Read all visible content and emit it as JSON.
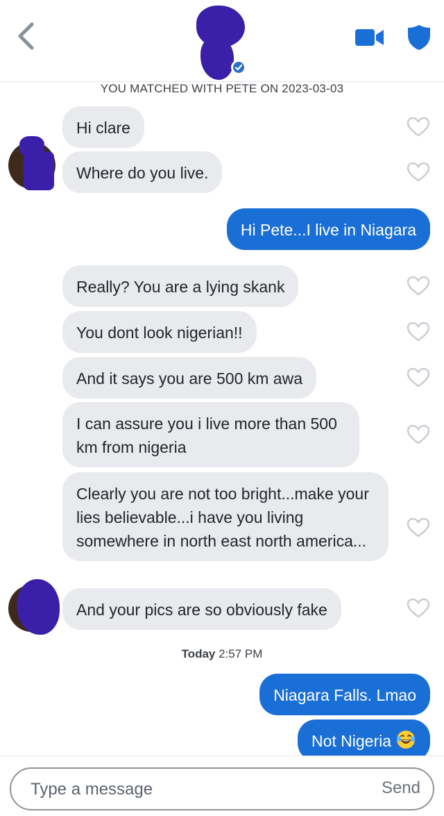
{
  "header": {
    "back_icon": "chevron-left-icon",
    "video_icon": "video-camera-icon",
    "safety_icon": "shield-icon",
    "verified_icon": "verified-check-icon",
    "accent_color": "#1a6fd6"
  },
  "match_banner": "YOU MATCHED WITH PETE ON 2023-03-03",
  "messages_before": [
    {
      "from": "them",
      "text": "Hi clare"
    },
    {
      "from": "them",
      "text": "Where do you live."
    },
    {
      "from": "me",
      "text": "Hi Pete...I live in Niagara"
    },
    {
      "from": "them",
      "text": "Really? You are a lying skank"
    },
    {
      "from": "them",
      "text": "You dont look nigerian!!"
    },
    {
      "from": "them",
      "text": "And it says you are 500 km awa"
    },
    {
      "from": "them",
      "text": "I can assure you i live more than 500 km from nigeria"
    },
    {
      "from": "them",
      "text": "Clearly you are not too bright...make your lies believable...i have you living somewhere in north east north america..."
    },
    {
      "from": "them",
      "text": "And your pics are so obviously fake"
    }
  ],
  "timestamp": {
    "day": "Today",
    "time": "2:57 PM"
  },
  "messages_after": [
    {
      "from": "me",
      "text": "Niagara Falls. Lmao"
    },
    {
      "from": "me",
      "text": "Not Nigeria",
      "emoji": "laughing-tears-emoji"
    }
  ],
  "composer": {
    "placeholder": "Type a message",
    "send_label": "Send"
  }
}
